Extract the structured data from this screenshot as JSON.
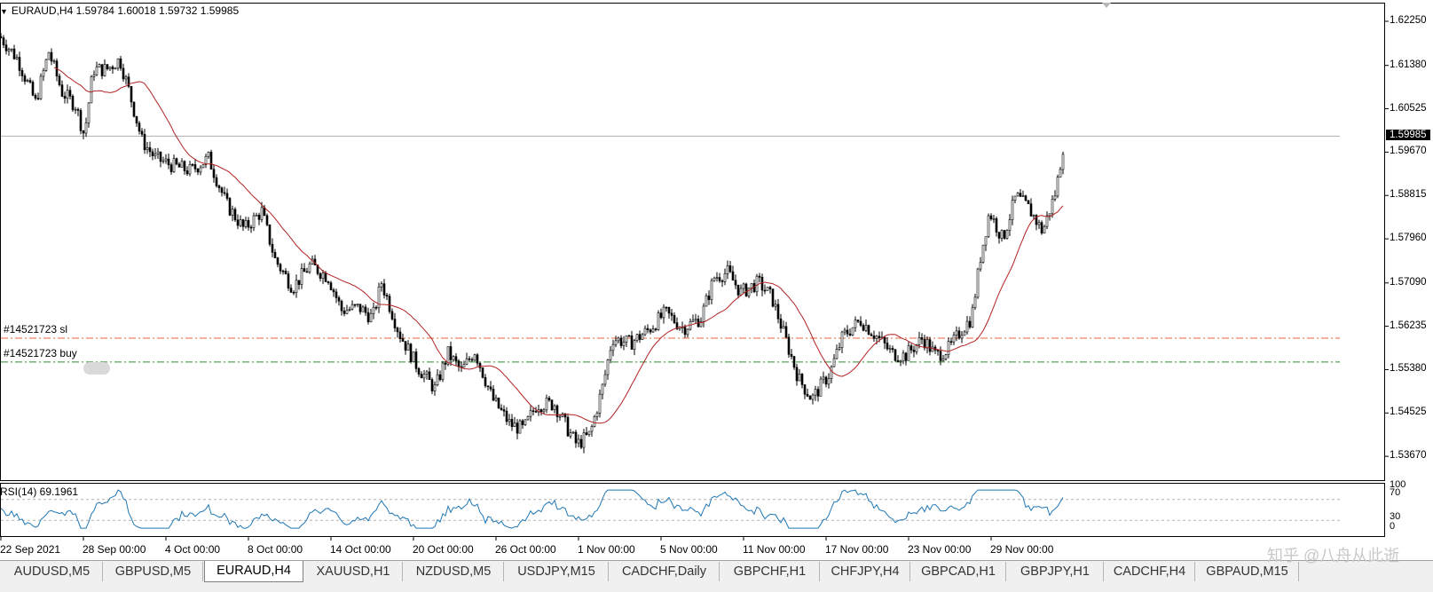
{
  "chart_header": {
    "arrow": "▼",
    "text": "EURAUD,H4  1.59784 1.60018 1.59732 1.59985"
  },
  "indicator": {
    "label": "RSI(14) 69.1961"
  },
  "orders": {
    "sl_label": "#14521723 sl",
    "buy_label": "#14521723 buy"
  },
  "price_axis": {
    "labels": [
      "1.62250",
      "1.61380",
      "1.60525",
      "1.59670",
      "1.58815",
      "1.57960",
      "1.57090",
      "1.56235",
      "1.55380",
      "1.54525",
      "1.53670"
    ],
    "current": "1.59985"
  },
  "rsi_axis": {
    "labels": [
      "100",
      "70",
      "30",
      "0"
    ]
  },
  "time_axis": {
    "labels": [
      "22 Sep 2021",
      "28 Sep 00:00",
      "4 Oct 00:00",
      "8 Oct 00:00",
      "14 Oct 00:00",
      "20 Oct 00:00",
      "26 Oct 00:00",
      "1 Nov 00:00",
      "5 Nov 00:00",
      "11 Nov 00:00",
      "17 Nov 00:00",
      "23 Nov 00:00",
      "29 Nov 00:00"
    ]
  },
  "tabs": [
    {
      "label": "AUDUSD,M5"
    },
    {
      "label": "GBPUSD,M5"
    },
    {
      "label": "EURAUD,H4",
      "active": true
    },
    {
      "label": "XAUUSD,H1"
    },
    {
      "label": "NZDUSD,M5"
    },
    {
      "label": "USDJPY,M15"
    },
    {
      "label": "CADCHF,Daily"
    },
    {
      "label": "GBPCHF,H1"
    },
    {
      "label": "CHFJPY,H4"
    },
    {
      "label": "GBPCAD,H1"
    },
    {
      "label": "GBPJPY,H1"
    },
    {
      "label": "CADCHF,H4"
    },
    {
      "label": "GBPAUD,M15"
    }
  ],
  "watermark": "知乎 @八舟从此逝",
  "colors": {
    "ma_line": "#b22222",
    "rsi_line": "#1f77b4",
    "sl_line": "#e8643c",
    "buy_line": "#2e8b2e"
  },
  "chart_data": {
    "type": "candlestick",
    "symbol": "EURAUD",
    "timeframe": "H4",
    "ylim": [
      1.532,
      1.626
    ],
    "current_price": 1.59985,
    "sl_price": 1.56,
    "buy_price": 1.5553,
    "price_path": [
      [
        0,
        1.6195
      ],
      [
        20,
        1.615
      ],
      [
        40,
        1.6065
      ],
      [
        55,
        1.6165
      ],
      [
        70,
        1.6085
      ],
      [
        85,
        1.606
      ],
      [
        95,
        1.6
      ],
      [
        105,
        1.613
      ],
      [
        120,
        1.613
      ],
      [
        135,
        1.615
      ],
      [
        145,
        1.609
      ],
      [
        160,
        1.599
      ],
      [
        175,
        1.5955
      ],
      [
        195,
        1.594
      ],
      [
        215,
        1.593
      ],
      [
        235,
        1.5955
      ],
      [
        255,
        1.5865
      ],
      [
        275,
        1.5815
      ],
      [
        295,
        1.585
      ],
      [
        310,
        1.5755
      ],
      [
        330,
        1.57
      ],
      [
        350,
        1.5745
      ],
      [
        370,
        1.572
      ],
      [
        385,
        1.5655
      ],
      [
        405,
        1.566
      ],
      [
        420,
        1.564
      ],
      [
        430,
        1.571
      ],
      [
        450,
        1.561
      ],
      [
        470,
        1.5545
      ],
      [
        490,
        1.55
      ],
      [
        505,
        1.557
      ],
      [
        520,
        1.5535
      ],
      [
        535,
        1.5575
      ],
      [
        555,
        1.548
      ],
      [
        575,
        1.543
      ],
      [
        590,
        1.542
      ],
      [
        605,
        1.547
      ],
      [
        625,
        1.547
      ],
      [
        640,
        1.542
      ],
      [
        650,
        1.539
      ],
      [
        665,
        1.541
      ],
      [
        680,
        1.551
      ],
      [
        690,
        1.56
      ],
      [
        710,
        1.559
      ],
      [
        730,
        1.5615
      ],
      [
        750,
        1.565
      ],
      [
        770,
        1.562
      ],
      [
        790,
        1.564
      ],
      [
        805,
        1.572
      ],
      [
        820,
        1.573
      ],
      [
        835,
        1.569
      ],
      [
        855,
        1.571
      ],
      [
        870,
        1.568
      ],
      [
        885,
        1.56
      ],
      [
        900,
        1.552
      ],
      [
        915,
        1.548
      ],
      [
        935,
        1.553
      ],
      [
        950,
        1.5605
      ],
      [
        970,
        1.5635
      ],
      [
        990,
        1.56
      ],
      [
        1005,
        1.557
      ],
      [
        1020,
        1.5565
      ],
      [
        1040,
        1.56
      ],
      [
        1055,
        1.5565
      ],
      [
        1070,
        1.558
      ],
      [
        1085,
        1.562
      ],
      [
        1095,
        1.564
      ],
      [
        1105,
        1.576
      ],
      [
        1115,
        1.585
      ],
      [
        1130,
        1.5795
      ],
      [
        1145,
        1.588
      ],
      [
        1160,
        1.5855
      ],
      [
        1175,
        1.581
      ],
      [
        1190,
        1.589
      ],
      [
        1200,
        1.59985
      ]
    ],
    "ma_period": 20,
    "rsi": {
      "period": 14,
      "current": 69.1961,
      "levels": [
        70,
        30
      ],
      "ylim": [
        0,
        100
      ]
    }
  }
}
